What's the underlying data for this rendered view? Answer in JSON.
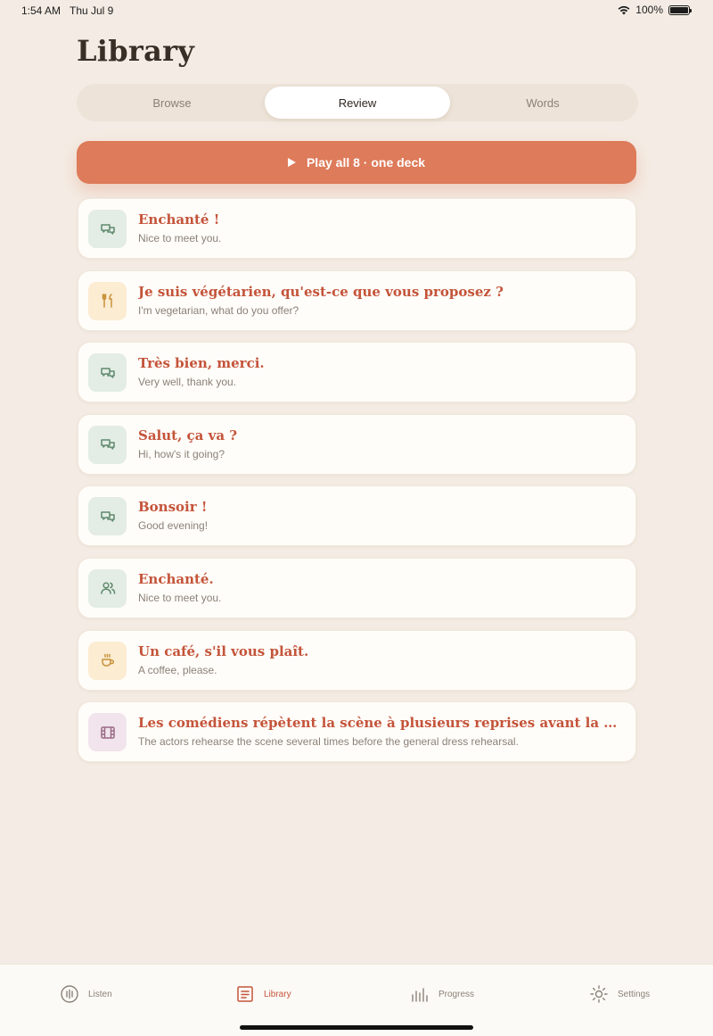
{
  "status_bar": {
    "time": "1:54 AM",
    "date": "Thu Jul 9",
    "battery": "100%"
  },
  "page": {
    "title": "Library"
  },
  "segments": [
    {
      "label": "Browse",
      "active": false
    },
    {
      "label": "Review",
      "active": true
    },
    {
      "label": "Words",
      "active": false
    }
  ],
  "play_button": {
    "label": "Play all 8 · one deck"
  },
  "phrases": [
    {
      "fr": "Enchanté !",
      "en": "Nice to meet you.",
      "icon": "chat-bubbles-icon",
      "color": "green"
    },
    {
      "fr": "Je suis végétarien, qu'est-ce que vous proposez ?",
      "en": "I'm vegetarian, what do you offer?",
      "icon": "fork-knife-icon",
      "color": "yellow"
    },
    {
      "fr": "Très bien, merci.",
      "en": "Very well, thank you.",
      "icon": "chat-bubbles-icon",
      "color": "green"
    },
    {
      "fr": "Salut, ça va ?",
      "en": "Hi, how's it going?",
      "icon": "chat-bubbles-icon",
      "color": "green"
    },
    {
      "fr": "Bonsoir !",
      "en": "Good evening!",
      "icon": "chat-bubbles-icon",
      "color": "green"
    },
    {
      "fr": "Enchanté.",
      "en": "Nice to meet you.",
      "icon": "people-icon",
      "color": "green"
    },
    {
      "fr": "Un café, s'il vous plaît.",
      "en": "A coffee, please.",
      "icon": "coffee-cup-icon",
      "color": "yellow"
    },
    {
      "fr": "Les comédiens répètent la scène à plusieurs reprises avant la génér...",
      "en": "The actors rehearse the scene several times before the general dress rehearsal.",
      "icon": "film-icon",
      "color": "purple"
    }
  ],
  "tabs": [
    {
      "label": "Listen",
      "icon": "waveform-circle-icon",
      "active": false
    },
    {
      "label": "Library",
      "icon": "library-list-icon",
      "active": true
    },
    {
      "label": "Progress",
      "icon": "bar-chart-icon",
      "active": false
    },
    {
      "label": "Settings",
      "icon": "sun-gear-icon",
      "active": false
    }
  ],
  "colors": {
    "background": "#f4ece4",
    "accent": "#dd7b5a",
    "phrase_text": "#c4543a",
    "green_icon_bg": "#e3ece5",
    "yellow_icon_bg": "#fbecd2",
    "purple_icon_bg": "#f1e4ec"
  }
}
